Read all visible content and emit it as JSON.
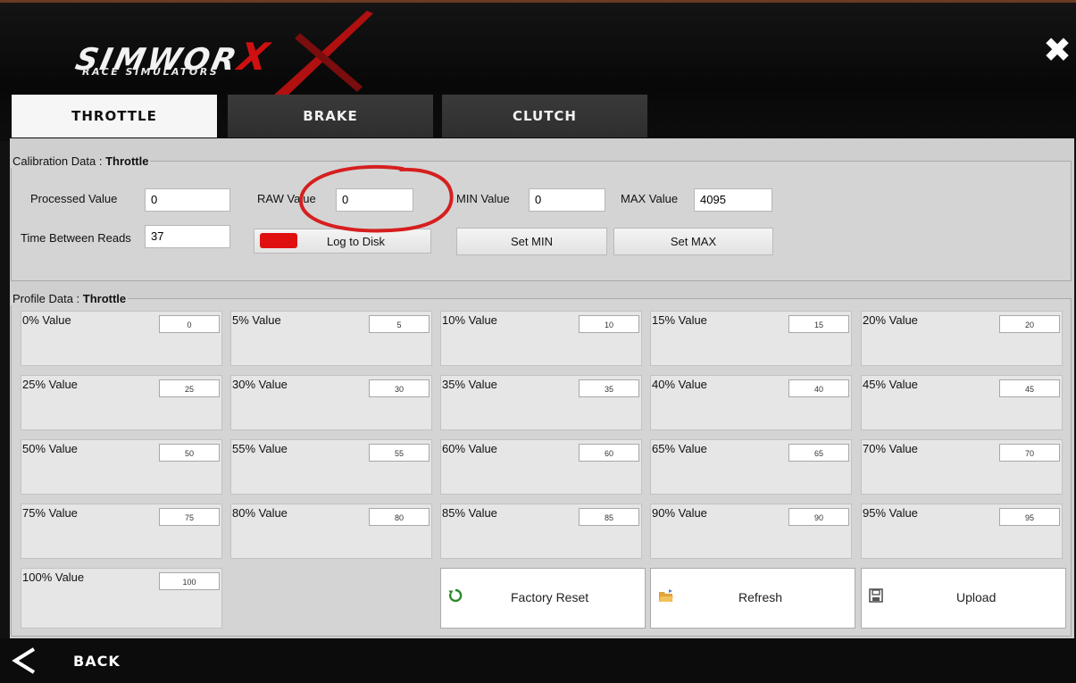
{
  "header": {
    "brand": "SIMWOR",
    "brand_x": "X",
    "tagline": "RACE SIMULATORS",
    "close_glyph": "✖"
  },
  "tabs": [
    {
      "label": "THROTTLE",
      "active": true
    },
    {
      "label": "BRAKE",
      "active": false
    },
    {
      "label": "CLUTCH",
      "active": false
    }
  ],
  "calibration": {
    "legend_prefix": "Calibration Data : ",
    "legend_name": "Throttle",
    "processed_label": "Processed Value",
    "processed_value": "0",
    "raw_label": "RAW Value",
    "raw_value": "0",
    "min_label": "MIN Value",
    "min_value": "0",
    "max_label": "MAX Value",
    "max_value": "4095",
    "time_label": "Time Between Reads",
    "time_value": "37",
    "log_label": "Log to Disk",
    "log_color": "#e01010",
    "set_min_label": "Set MIN",
    "set_max_label": "Set MAX",
    "annotation_color": "#d61f1f"
  },
  "profile": {
    "legend_prefix": "Profile Data : ",
    "legend_name": "Throttle",
    "values": [
      {
        "label": "0% Value",
        "value": "0"
      },
      {
        "label": "5% Value",
        "value": "5"
      },
      {
        "label": "10% Value",
        "value": "10"
      },
      {
        "label": "15% Value",
        "value": "15"
      },
      {
        "label": "20% Value",
        "value": "20"
      },
      {
        "label": "25% Value",
        "value": "25"
      },
      {
        "label": "30% Value",
        "value": "30"
      },
      {
        "label": "35% Value",
        "value": "35"
      },
      {
        "label": "40% Value",
        "value": "40"
      },
      {
        "label": "45% Value",
        "value": "45"
      },
      {
        "label": "50% Value",
        "value": "50"
      },
      {
        "label": "55% Value",
        "value": "55"
      },
      {
        "label": "60% Value",
        "value": "60"
      },
      {
        "label": "65% Value",
        "value": "65"
      },
      {
        "label": "70% Value",
        "value": "70"
      },
      {
        "label": "75% Value",
        "value": "75"
      },
      {
        "label": "80% Value",
        "value": "80"
      },
      {
        "label": "85% Value",
        "value": "85"
      },
      {
        "label": "90% Value",
        "value": "90"
      },
      {
        "label": "95% Value",
        "value": "95"
      },
      {
        "label": "100% Value",
        "value": "100"
      }
    ]
  },
  "actions": {
    "factory_reset": "Factory Reset",
    "refresh": "Refresh",
    "upload": "Upload",
    "reset_icon": "reset-icon",
    "refresh_icon": "folder-icon",
    "upload_icon": "save-icon"
  },
  "footer": {
    "back_label": "BACK"
  }
}
